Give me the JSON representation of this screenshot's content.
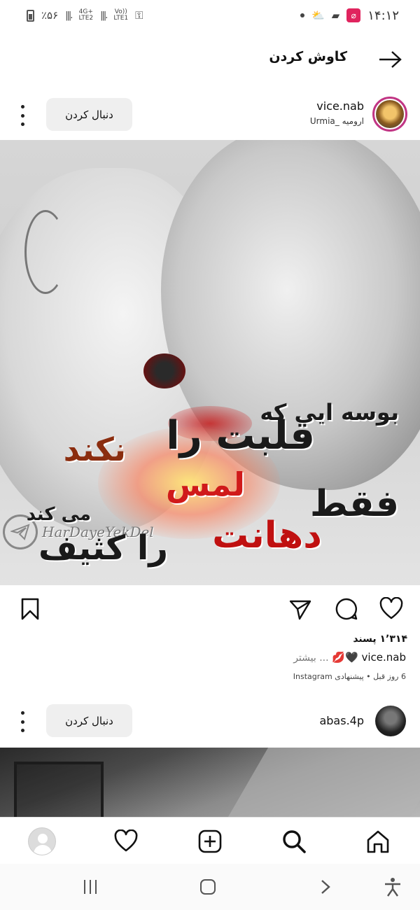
{
  "status_bar": {
    "battery": "٪۵۶",
    "network_1": "4G+",
    "network_1b": "LTE2",
    "network_2": "Vo))",
    "network_2b": "LTE1",
    "time": "۱۴:۱۲"
  },
  "header": {
    "title": "کاوش کردن",
    "back_icon": "arrow-right-icon"
  },
  "posts": [
    {
      "username": "vice.nab",
      "location": "ارومیه _Urmia",
      "follow_label": "دنبال کردن",
      "image_text": {
        "line1": "بوسه ایی که",
        "line2": "قلبت را",
        "line3": "نکند",
        "line4": "لمس",
        "line5": "فقط",
        "line6": "می کند",
        "line7": "دهانت",
        "line8": "را کثیف"
      },
      "watermark": "HarDayeYekDel",
      "likes": "۱٬۳۱۴ پسند",
      "caption_user": "vice.nab",
      "caption_emoji": "🖤💋",
      "caption_more": "... بیشتر",
      "meta": "6 روز قبل • پیشنهادی Instagram"
    },
    {
      "username": "abas.4p",
      "follow_label": "دنبال کردن"
    }
  ],
  "bottom_nav": {
    "items": [
      "profile-icon",
      "heart-icon",
      "create-icon",
      "search-icon",
      "home-icon"
    ]
  },
  "system_nav": {
    "items": [
      "recents-icon",
      "home-button-icon",
      "back-chevron-icon",
      "accessibility-icon"
    ]
  },
  "colors": {
    "accent_ring": "#c13584",
    "follow_bg": "#efefef",
    "poem_red": "#d01a1a"
  }
}
